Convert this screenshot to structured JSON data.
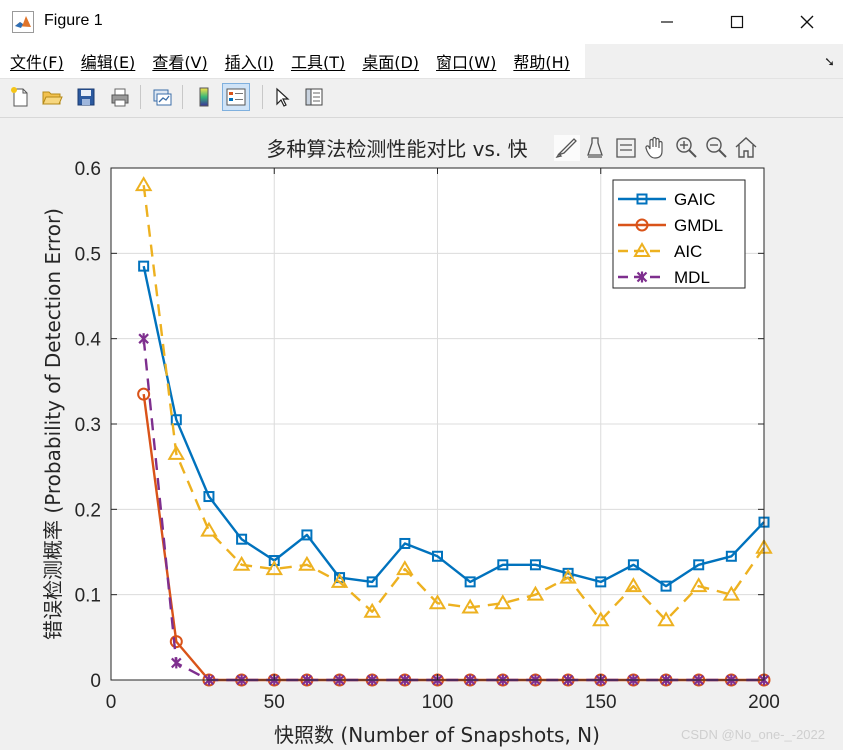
{
  "window": {
    "title": "Figure 1"
  },
  "menu": [
    "文件(F)",
    "编辑(E)",
    "查看(V)",
    "插入(I)",
    "工具(T)",
    "桌面(D)",
    "窗口(W)",
    "帮助(H)"
  ],
  "toolbar_icons": [
    "new-figure-icon",
    "open-file-icon",
    "save-icon",
    "print-icon",
    "link-plot-icon",
    "colorbar-icon",
    "legend-icon",
    "pointer-icon",
    "property-inspector-icon"
  ],
  "axes_toolbar_icons": [
    "brush-icon",
    "data-tips-icon",
    "data-tips-alt-icon",
    "pan-hand-icon",
    "zoom-in-icon",
    "zoom-out-icon",
    "home-icon"
  ],
  "watermark": "CSDN @No_one-_-2022",
  "chart_data": {
    "type": "line",
    "title": "多种算法检测性能对比 vs. 快",
    "xlabel": "快照数 (Number of Snapshots, N)",
    "ylabel": "错误检测概率 (Probability of Detection Error)",
    "xlim": [
      0,
      200
    ],
    "ylim": [
      0,
      0.6
    ],
    "xticks": [
      0,
      50,
      100,
      150,
      200
    ],
    "yticks": [
      0,
      0.1,
      0.2,
      0.3,
      0.4,
      0.5,
      0.6
    ],
    "xtick_labels": [
      "0",
      "50",
      "100",
      "150",
      "200"
    ],
    "ytick_labels": [
      "0",
      "0.1",
      "0.2",
      "0.3",
      "0.4",
      "0.5",
      "0.6"
    ],
    "grid": true,
    "legend_position": "top-right",
    "x": [
      10,
      20,
      30,
      40,
      50,
      60,
      70,
      80,
      90,
      100,
      110,
      120,
      130,
      140,
      150,
      160,
      170,
      180,
      190,
      200
    ],
    "series": [
      {
        "name": "GAIC",
        "color": "#0072bd",
        "linestyle": "solid",
        "marker": "square",
        "values": [
          0.485,
          0.305,
          0.215,
          0.165,
          0.14,
          0.17,
          0.12,
          0.115,
          0.16,
          0.145,
          0.115,
          0.135,
          0.135,
          0.125,
          0.115,
          0.135,
          0.11,
          0.135,
          0.145,
          0.185
        ]
      },
      {
        "name": "GMDL",
        "color": "#d95319",
        "linestyle": "solid",
        "marker": "circle",
        "values": [
          0.335,
          0.045,
          0,
          0,
          0,
          0,
          0,
          0,
          0,
          0,
          0,
          0,
          0,
          0,
          0,
          0,
          0,
          0,
          0,
          0
        ]
      },
      {
        "name": "AIC",
        "color": "#edb120",
        "linestyle": "dashed",
        "marker": "triangle",
        "values": [
          0.58,
          0.265,
          0.175,
          0.135,
          0.13,
          0.135,
          0.115,
          0.08,
          0.13,
          0.09,
          0.085,
          0.09,
          0.1,
          0.12,
          0.07,
          0.11,
          0.07,
          0.11,
          0.1,
          0.155
        ]
      },
      {
        "name": "MDL",
        "color": "#7e2f8e",
        "linestyle": "dashed",
        "marker": "asterisk",
        "values": [
          0.4,
          0.02,
          0,
          0,
          0,
          0,
          0,
          0,
          0,
          0,
          0,
          0,
          0,
          0,
          0,
          0,
          0,
          0,
          0,
          0
        ]
      }
    ]
  }
}
